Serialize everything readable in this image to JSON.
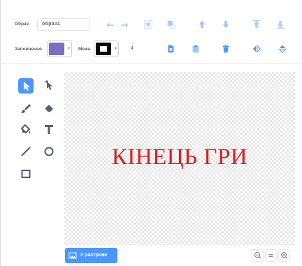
{
  "toolbar": {
    "name_label": "Образ",
    "costume_name": "образ1",
    "fill_label": "Заповнення",
    "outline_label": "Межа",
    "outline_width": "4",
    "fill_color": "#7b6ec4",
    "outline_color": "#000000",
    "icon_color": "#4c97ff"
  },
  "tools": [
    {
      "name": "select",
      "active": true
    },
    {
      "name": "reshape"
    },
    {
      "name": "brush"
    },
    {
      "name": "eraser"
    },
    {
      "name": "fill"
    },
    {
      "name": "text"
    },
    {
      "name": "line"
    },
    {
      "name": "circle"
    },
    {
      "name": "rectangle"
    }
  ],
  "canvas": {
    "text": "КІНЕЦЬ ГРИ",
    "text_color": "#e01b1b"
  },
  "bottom": {
    "convert_button": "У растрове"
  }
}
